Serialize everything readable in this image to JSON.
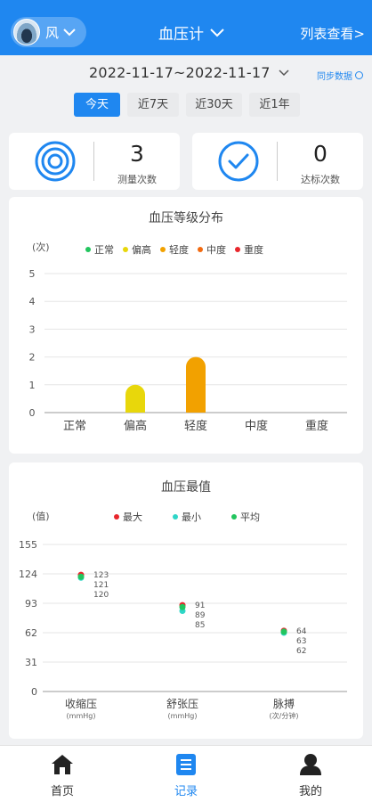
{
  "header": {
    "profile_name": "风",
    "title": "血压计",
    "list_view": "列表查看>"
  },
  "filter": {
    "date_range": "2022-11-17~2022-11-17",
    "sync": "同步数据",
    "tabs": [
      "今天",
      "近7天",
      "近30天",
      "近1年"
    ],
    "active_tab": 0
  },
  "stats": {
    "measure": {
      "value": "3",
      "label": "测量次数",
      "icon": "target-icon"
    },
    "reach": {
      "value": "0",
      "label": "达标次数",
      "icon": "check-circle-icon"
    }
  },
  "colors": {
    "accent": "#1f87f0",
    "normal": "#22c55e",
    "high_normal": "#e8d70b",
    "mild": "#f2a100",
    "moderate": "#f26a10",
    "severe": "#e8262c",
    "max": "#e8262c",
    "min": "#2fd6c8",
    "avg": "#22c55e"
  },
  "chart_data": [
    {
      "type": "bar",
      "title": "血压等级分布",
      "ylabel": "(次)",
      "ylim": [
        0,
        5
      ],
      "yticks": [
        0,
        1,
        2,
        3,
        4,
        5
      ],
      "categories": [
        "正常",
        "偏高",
        "轻度",
        "中度",
        "重度"
      ],
      "legend": [
        "正常",
        "偏高",
        "轻度",
        "中度",
        "重度"
      ],
      "legend_colors": [
        "#22c55e",
        "#e8d70b",
        "#f2a100",
        "#f26a10",
        "#e8262c"
      ],
      "values": [
        0,
        1,
        2,
        0,
        0
      ],
      "grid": true,
      "legend_position": "top"
    },
    {
      "type": "scatter",
      "title": "血压最值",
      "ylabel": "(值)",
      "ylim": [
        0,
        155
      ],
      "yticks": [
        0,
        31,
        62,
        93,
        124,
        155
      ],
      "categories": [
        "收缩压",
        "舒张压",
        "脉搏"
      ],
      "category_units": [
        "(mmHg)",
        "(mmHg)",
        "(次/分钟)"
      ],
      "series": [
        {
          "name": "最大",
          "color": "#e8262c",
          "values": [
            123,
            91,
            64
          ]
        },
        {
          "name": "最小",
          "color": "#2fd6c8",
          "values": [
            120,
            85,
            62
          ]
        },
        {
          "name": "平均",
          "color": "#22c55e",
          "values": [
            121,
            89,
            63
          ]
        }
      ],
      "grid": true,
      "legend_position": "top"
    }
  ],
  "nav": [
    {
      "label": "首页",
      "icon": "home-icon"
    },
    {
      "label": "记录",
      "icon": "record-icon"
    },
    {
      "label": "我的",
      "icon": "user-icon"
    }
  ],
  "nav_active": 1
}
